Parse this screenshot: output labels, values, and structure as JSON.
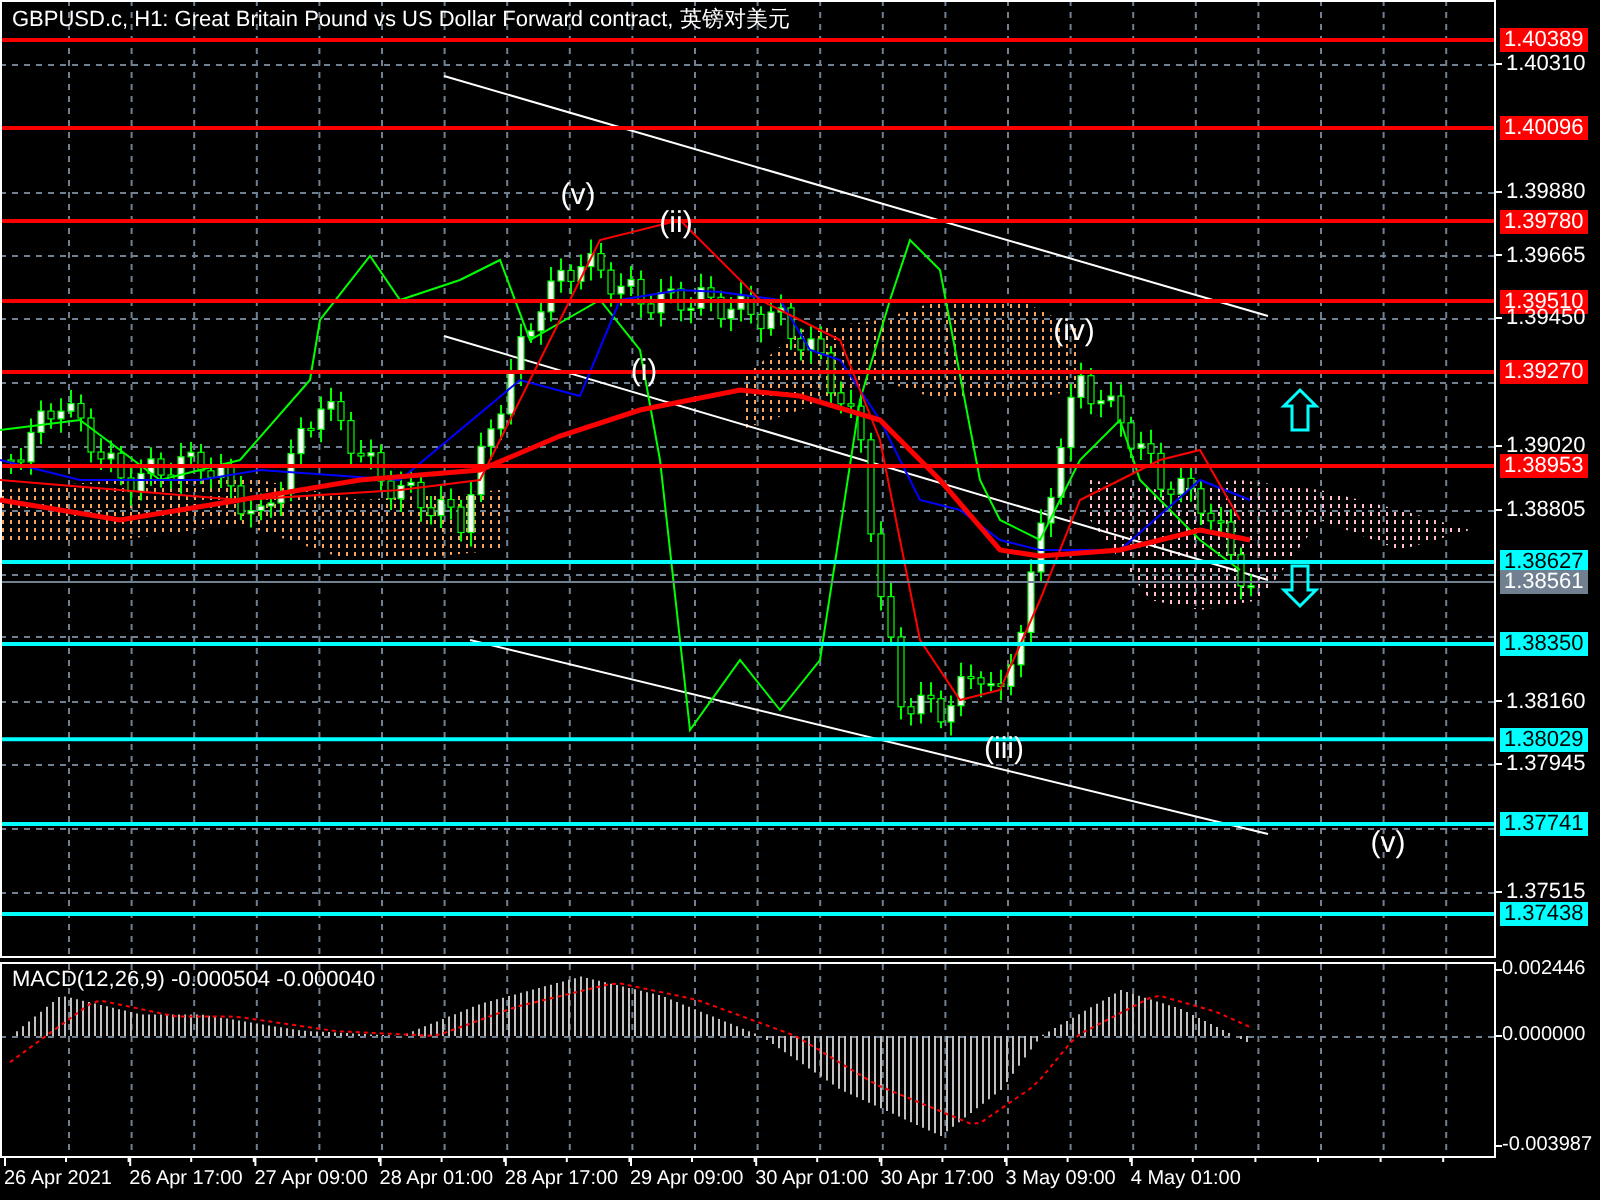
{
  "title": "GBPUSD.c, H1:  Great Britain Pound vs US Dollar Forward contract, 英镑对美元",
  "price_axis": {
    "ticks": [
      "1.40310",
      "1.39880",
      "1.39665",
      "1.39450",
      "1.39020",
      "1.38805",
      "1.38160",
      "1.37945",
      "1.37515"
    ]
  },
  "price_levels": [
    {
      "label": "1.40389",
      "color": "#ff0000"
    },
    {
      "label": "1.40096",
      "color": "#ff0000"
    },
    {
      "label": "1.39780",
      "color": "#ff0000"
    },
    {
      "label": "1.39510",
      "color": "#ff0000"
    },
    {
      "label": "1.39270",
      "color": "#ff0000"
    },
    {
      "label": "1.38953",
      "color": "#ff0000"
    },
    {
      "label": "1.38627",
      "color": "#00ffff"
    },
    {
      "label": "1.38561",
      "color": "#708090"
    },
    {
      "label": "1.38350",
      "color": "#00ffff"
    },
    {
      "label": "1.38029",
      "color": "#00ffff"
    },
    {
      "label": "1.37741",
      "color": "#00ffff"
    },
    {
      "label": "1.37438",
      "color": "#00ffff"
    }
  ],
  "wave_labels": [
    "(v)",
    "(ii)",
    "(i)",
    "(iv)",
    "(iii)",
    "(v)"
  ],
  "macd": {
    "label": "MACD(12,26,9) -0.000504 -0.000040",
    "axis_ticks": [
      "0.002446",
      "0.000000",
      "-0.003987"
    ]
  },
  "time_axis": [
    "26 Apr 2021",
    "26 Apr 17:00",
    "27 Apr 09:00",
    "28 Apr 01:00",
    "28 Apr 17:00",
    "29 Apr 09:00",
    "30 Apr 01:00",
    "30 Apr 17:00",
    "3 May 09:00",
    "4 May 01:00"
  ]
}
